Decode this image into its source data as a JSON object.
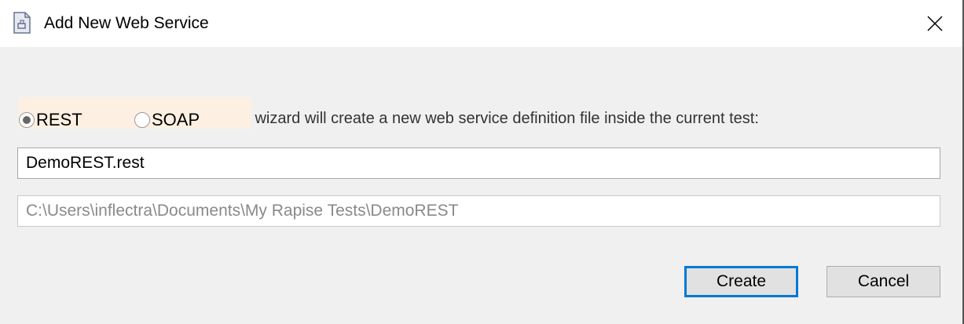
{
  "window": {
    "title": "Add New Web Service",
    "icon": "document-icon",
    "close_icon": "close-icon"
  },
  "intro_text": "This wizard will create a new web service definition file inside the current test:",
  "service_type": {
    "options": [
      {
        "label": "REST",
        "selected": true
      },
      {
        "label": "SOAP",
        "selected": false
      }
    ],
    "panel_color": "#fdf0e2"
  },
  "name_field": {
    "value": "DemoREST.rest"
  },
  "path_field": {
    "value": "C:\\Users\\inflectra\\Documents\\My Rapise Tests\\DemoREST",
    "disabled": true
  },
  "buttons": {
    "create": "Create",
    "cancel": "Cancel"
  },
  "colors": {
    "accent": "#0078d7"
  }
}
